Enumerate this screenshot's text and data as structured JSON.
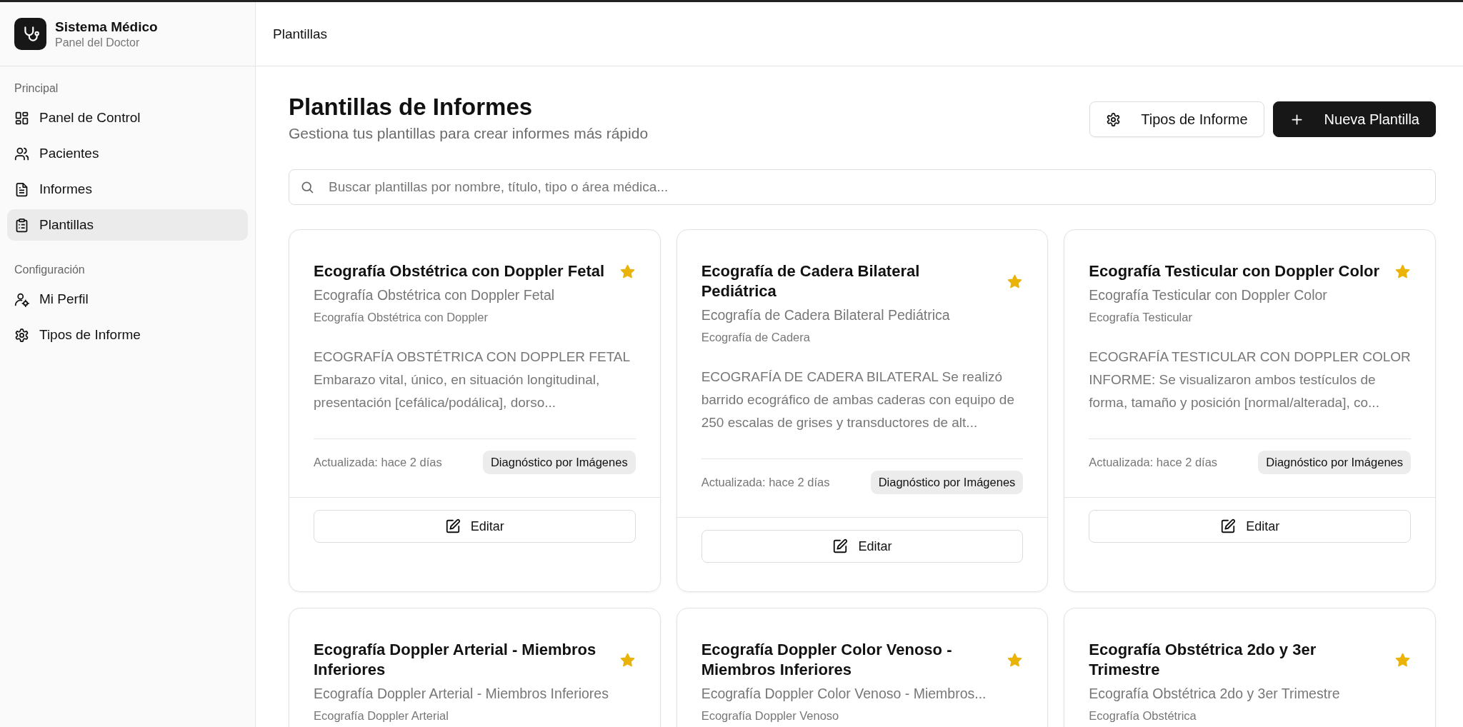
{
  "sidebar": {
    "brand": {
      "title": "Sistema Médico",
      "subtitle": "Panel del Doctor"
    },
    "sections": [
      {
        "label": "Principal",
        "items": [
          {
            "label": "Panel de Control",
            "selected": false
          },
          {
            "label": "Pacientes",
            "selected": false
          },
          {
            "label": "Informes",
            "selected": false
          },
          {
            "label": "Plantillas",
            "selected": true
          }
        ]
      },
      {
        "label": "Configuración",
        "items": [
          {
            "label": "Mi Perfil",
            "selected": false
          },
          {
            "label": "Tipos de Informe",
            "selected": false
          }
        ]
      }
    ]
  },
  "topbar": {
    "breadcrumb": "Plantillas"
  },
  "page": {
    "title": "Plantillas de Informes",
    "subtitle": "Gestiona tus plantillas para crear informes más rápido",
    "buttons": [
      {
        "label": "Tipos de Informe",
        "kind": "secondary"
      },
      {
        "label": "Nueva Plantilla",
        "kind": "primary"
      }
    ],
    "search": {
      "placeholder": "Buscar plantillas por nombre, título, tipo o área médica..."
    }
  },
  "templates": [
    {
      "title": "Ecografía Obstétrica con Doppler Fetal",
      "favorite": true,
      "subtitle": "Ecografía Obstétrica con Doppler Fetal",
      "type": "Ecografía Obstétrica con Doppler",
      "description": "ECOGRAFÍA OBSTÉTRICA CON DOPPLER FETAL Embarazo vital, único, en situación longitudinal, presentación [cefálica/podálica], dorso...",
      "updated_label": "Actualizada:",
      "updated_value": "hace 2 días",
      "tag": "Diagnóstico por Imágenes",
      "edit_label": "Editar"
    },
    {
      "title": "Ecografía de Cadera Bilateral Pediátrica",
      "favorite": true,
      "subtitle": "Ecografía de Cadera Bilateral Pediátrica",
      "type": "Ecografía de Cadera",
      "description": "ECOGRAFÍA DE CADERA BILATERAL Se realizó barrido ecográfico de ambas caderas con equipo de 250 escalas de grises y transductores de alt...",
      "updated_label": "Actualizada:",
      "updated_value": "hace 2 días",
      "tag": "Diagnóstico por Imágenes",
      "edit_label": "Editar"
    },
    {
      "title": "Ecografía Testicular con Doppler Color",
      "favorite": true,
      "subtitle": "Ecografía Testicular con Doppler Color",
      "type": "Ecografía Testicular",
      "description": "ECOGRAFÍA TESTICULAR CON DOPPLER COLOR INFORME: Se visualizaron ambos testículos de forma, tamaño y posición [normal/alterada], co...",
      "updated_label": "Actualizada:",
      "updated_value": "hace 2 días",
      "tag": "Diagnóstico por Imágenes",
      "edit_label": "Editar"
    },
    {
      "title": "Ecografía Doppler Arterial - Miembros Inferiores",
      "favorite": true,
      "subtitle": "Ecografía Doppler Arterial - Miembros Inferiores",
      "type": "Ecografía Doppler Arterial"
    },
    {
      "title": "Ecografía Doppler Color Venoso - Miembros Inferiores",
      "favorite": true,
      "subtitle": "Ecografía Doppler Color Venoso - Miembros...",
      "type": "Ecografía Doppler Venoso"
    },
    {
      "title": "Ecografía Obstétrica 2do y 3er Trimestre",
      "favorite": true,
      "subtitle": "Ecografía Obstétrica 2do y 3er Trimestre",
      "type": "Ecografía Obstétrica"
    }
  ]
}
